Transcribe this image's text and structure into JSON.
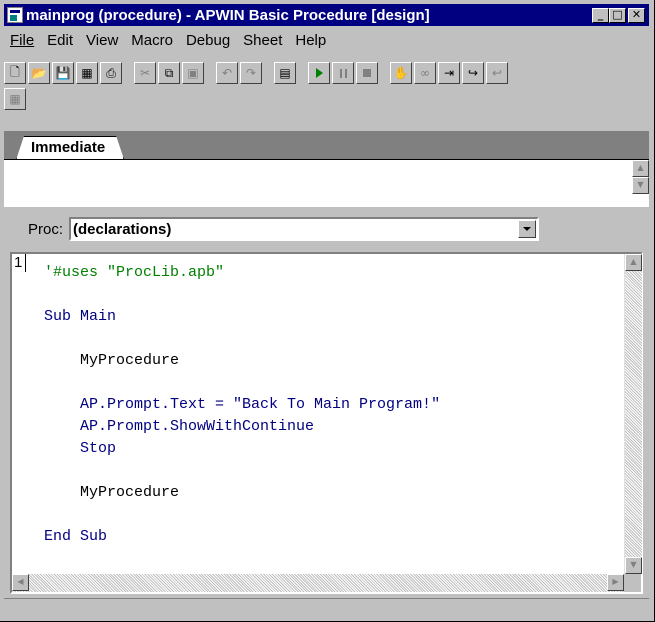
{
  "window": {
    "title": "mainprog (procedure) - APWIN Basic Procedure [design]",
    "minimize": "_",
    "maximize": "□",
    "close": "✕"
  },
  "menu": [
    {
      "label": "File"
    },
    {
      "label": "Edit"
    },
    {
      "label": "View"
    },
    {
      "label": "Macro"
    },
    {
      "label": "Debug"
    },
    {
      "label": "Sheet"
    },
    {
      "label": "Help"
    }
  ],
  "toolbar": {
    "row1": [
      "new-icon",
      "open-icon",
      "save-icon",
      "save-all-icon",
      "print-icon",
      "cut-icon",
      "copy-icon",
      "paste-icon",
      "undo-icon",
      "redo-icon",
      "dialog-editor-icon",
      "run-icon",
      "pause-icon",
      "stop-icon",
      "toggle-breakpoint-icon",
      "quick-watch-icon",
      "step-into-icon",
      "step-over-icon",
      "step-out-icon"
    ],
    "row2": [
      "object-browser-icon"
    ]
  },
  "immediate_tab": {
    "label": "Immediate"
  },
  "proc": {
    "label": "Proc:",
    "selected": "(declarations)"
  },
  "editor": {
    "line_number": "1",
    "lines": [
      "'#uses \"ProcLib.apb\"",
      "",
      "Sub Main",
      "",
      "    MyProcedure",
      "",
      "    AP.Prompt.Text = \"Back To Main Program!\"",
      "    AP.Prompt.ShowWithContinue",
      "    Stop",
      "",
      "    MyProcedure",
      "",
      "End Sub"
    ]
  }
}
